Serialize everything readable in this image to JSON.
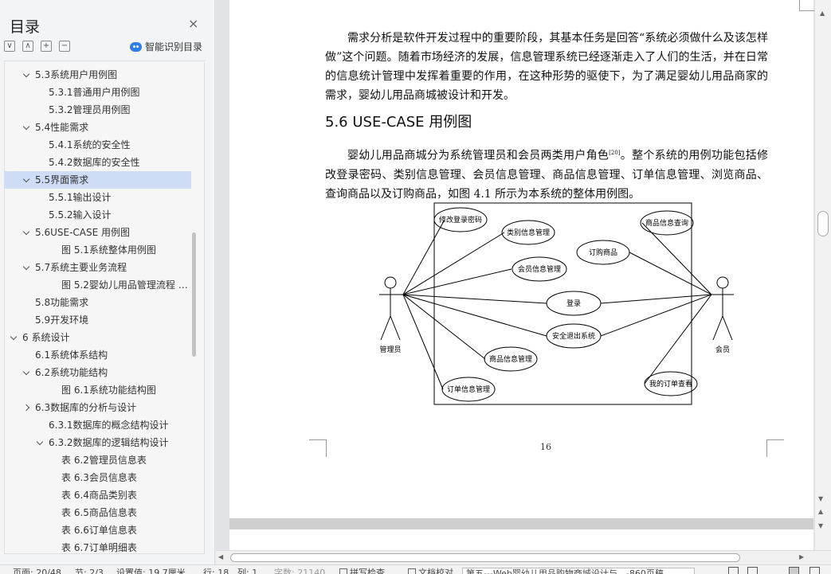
{
  "sidebar": {
    "title": "目录",
    "close_icon": "×",
    "tools": [
      "∨",
      "∧",
      "+",
      "−"
    ],
    "smart_label": "智能识别目录",
    "toc": [
      {
        "label": "5.3系统用户用例图",
        "level": 1,
        "chevron": "down"
      },
      {
        "label": "5.3.1普通用户用例图",
        "level": 2
      },
      {
        "label": "5.3.2管理员用例图",
        "level": 2
      },
      {
        "label": "5.4性能需求",
        "level": 1,
        "chevron": "down"
      },
      {
        "label": "5.4.1系统的安全性",
        "level": 2
      },
      {
        "label": "5.4.2数据库的安全性",
        "level": 2
      },
      {
        "label": "5.5界面需求",
        "level": 1,
        "chevron": "down",
        "selected": true
      },
      {
        "label": "5.5.1输出设计",
        "level": 2
      },
      {
        "label": "5.5.2输入设计",
        "level": 2
      },
      {
        "label": "5.6USE-CASE 用例图",
        "level": 1,
        "chevron": "down"
      },
      {
        "label": "图 5.1系统整体用例图",
        "level": 3
      },
      {
        "label": "5.7系统主要业务流程",
        "level": 1,
        "chevron": "down"
      },
      {
        "label": "图 5.2婴幼儿用品管理流程 …",
        "level": 3
      },
      {
        "label": "5.8功能需求",
        "level": 1
      },
      {
        "label": "5.9开发环境",
        "level": 1
      },
      {
        "label": "6   系统设计",
        "level": 0,
        "chevron": "down"
      },
      {
        "label": "6.1系统体系结构",
        "level": 1
      },
      {
        "label": "6.2系统功能结构",
        "level": 1,
        "chevron": "down"
      },
      {
        "label": "图 6.1系统功能结构图",
        "level": 3
      },
      {
        "label": "6.3数据库的分析与设计",
        "level": 1,
        "chevron": "right"
      },
      {
        "label": "6.3.1数据库的概念结构设计",
        "level": 2
      },
      {
        "label": "6.3.2数据库的逻辑结构设计",
        "level": 2,
        "chevron": "down"
      },
      {
        "label": "表 6.2管理员信息表",
        "level": 3
      },
      {
        "label": "表 6.3会员信息表",
        "level": 3
      },
      {
        "label": "表 6.4商品类别表",
        "level": 3
      },
      {
        "label": "表 6.5商品信息表",
        "level": 3
      },
      {
        "label": "表 6.6订单信息表",
        "level": 3
      },
      {
        "label": "表 6.7订单明细表",
        "level": 3
      }
    ]
  },
  "document": {
    "para1": "需求分析是软件开发过程中的重要阶段，其基本任务是回答“系统必须做什么及该怎样做”这个问题。随着市场经济的发展，信息管理系统已经逐渐走入了人们的生活，并在日常的信息统计管理中发挥着重要的作用，在这种形势的驱使下，为了满足婴幼儿用品商家的需求，婴幼儿用品商城被设计和开发。",
    "heading": "5.6 USE-CASE 用例图",
    "para2_a": "婴幼儿用品商城分为系统管理员和会员两类用户角色",
    "para2_ref": "[20]",
    "para2_b": "。整个系统的用例功能包括修改登录密码、类别信息管理、会员信息管理、商品信息管理、订单信息管理、浏览商品、查询商品以及订购商品，如图 4.1 所示为本系统的整体用例图。",
    "page_number": "16",
    "diagram": {
      "actor_left": "管理员",
      "actor_right": "会员",
      "usecases": {
        "change_pwd": "修改登录密码",
        "category_mgmt": "类别信息管理",
        "member_mgmt": "会员信息管理",
        "login": "登录",
        "logout": "安全退出系统",
        "product_mgmt": "商品信息管理",
        "order_mgmt": "订单信息管理",
        "product_query": "商品信息查询",
        "buy": "订购商品",
        "my_orders": "我的订单查看"
      }
    }
  },
  "statusbar": {
    "page": "页面: 20/48",
    "section": "节: 2/3",
    "setting": "设置值: 19.7厘米",
    "row": "行: 18",
    "col": "列: 1",
    "word_count": "字数: 21140",
    "spellcheck": "拼写检查",
    "doc_check": "文档校对",
    "file": "第五---Web婴幼儿用品购物商城设计与…-860页稿"
  }
}
